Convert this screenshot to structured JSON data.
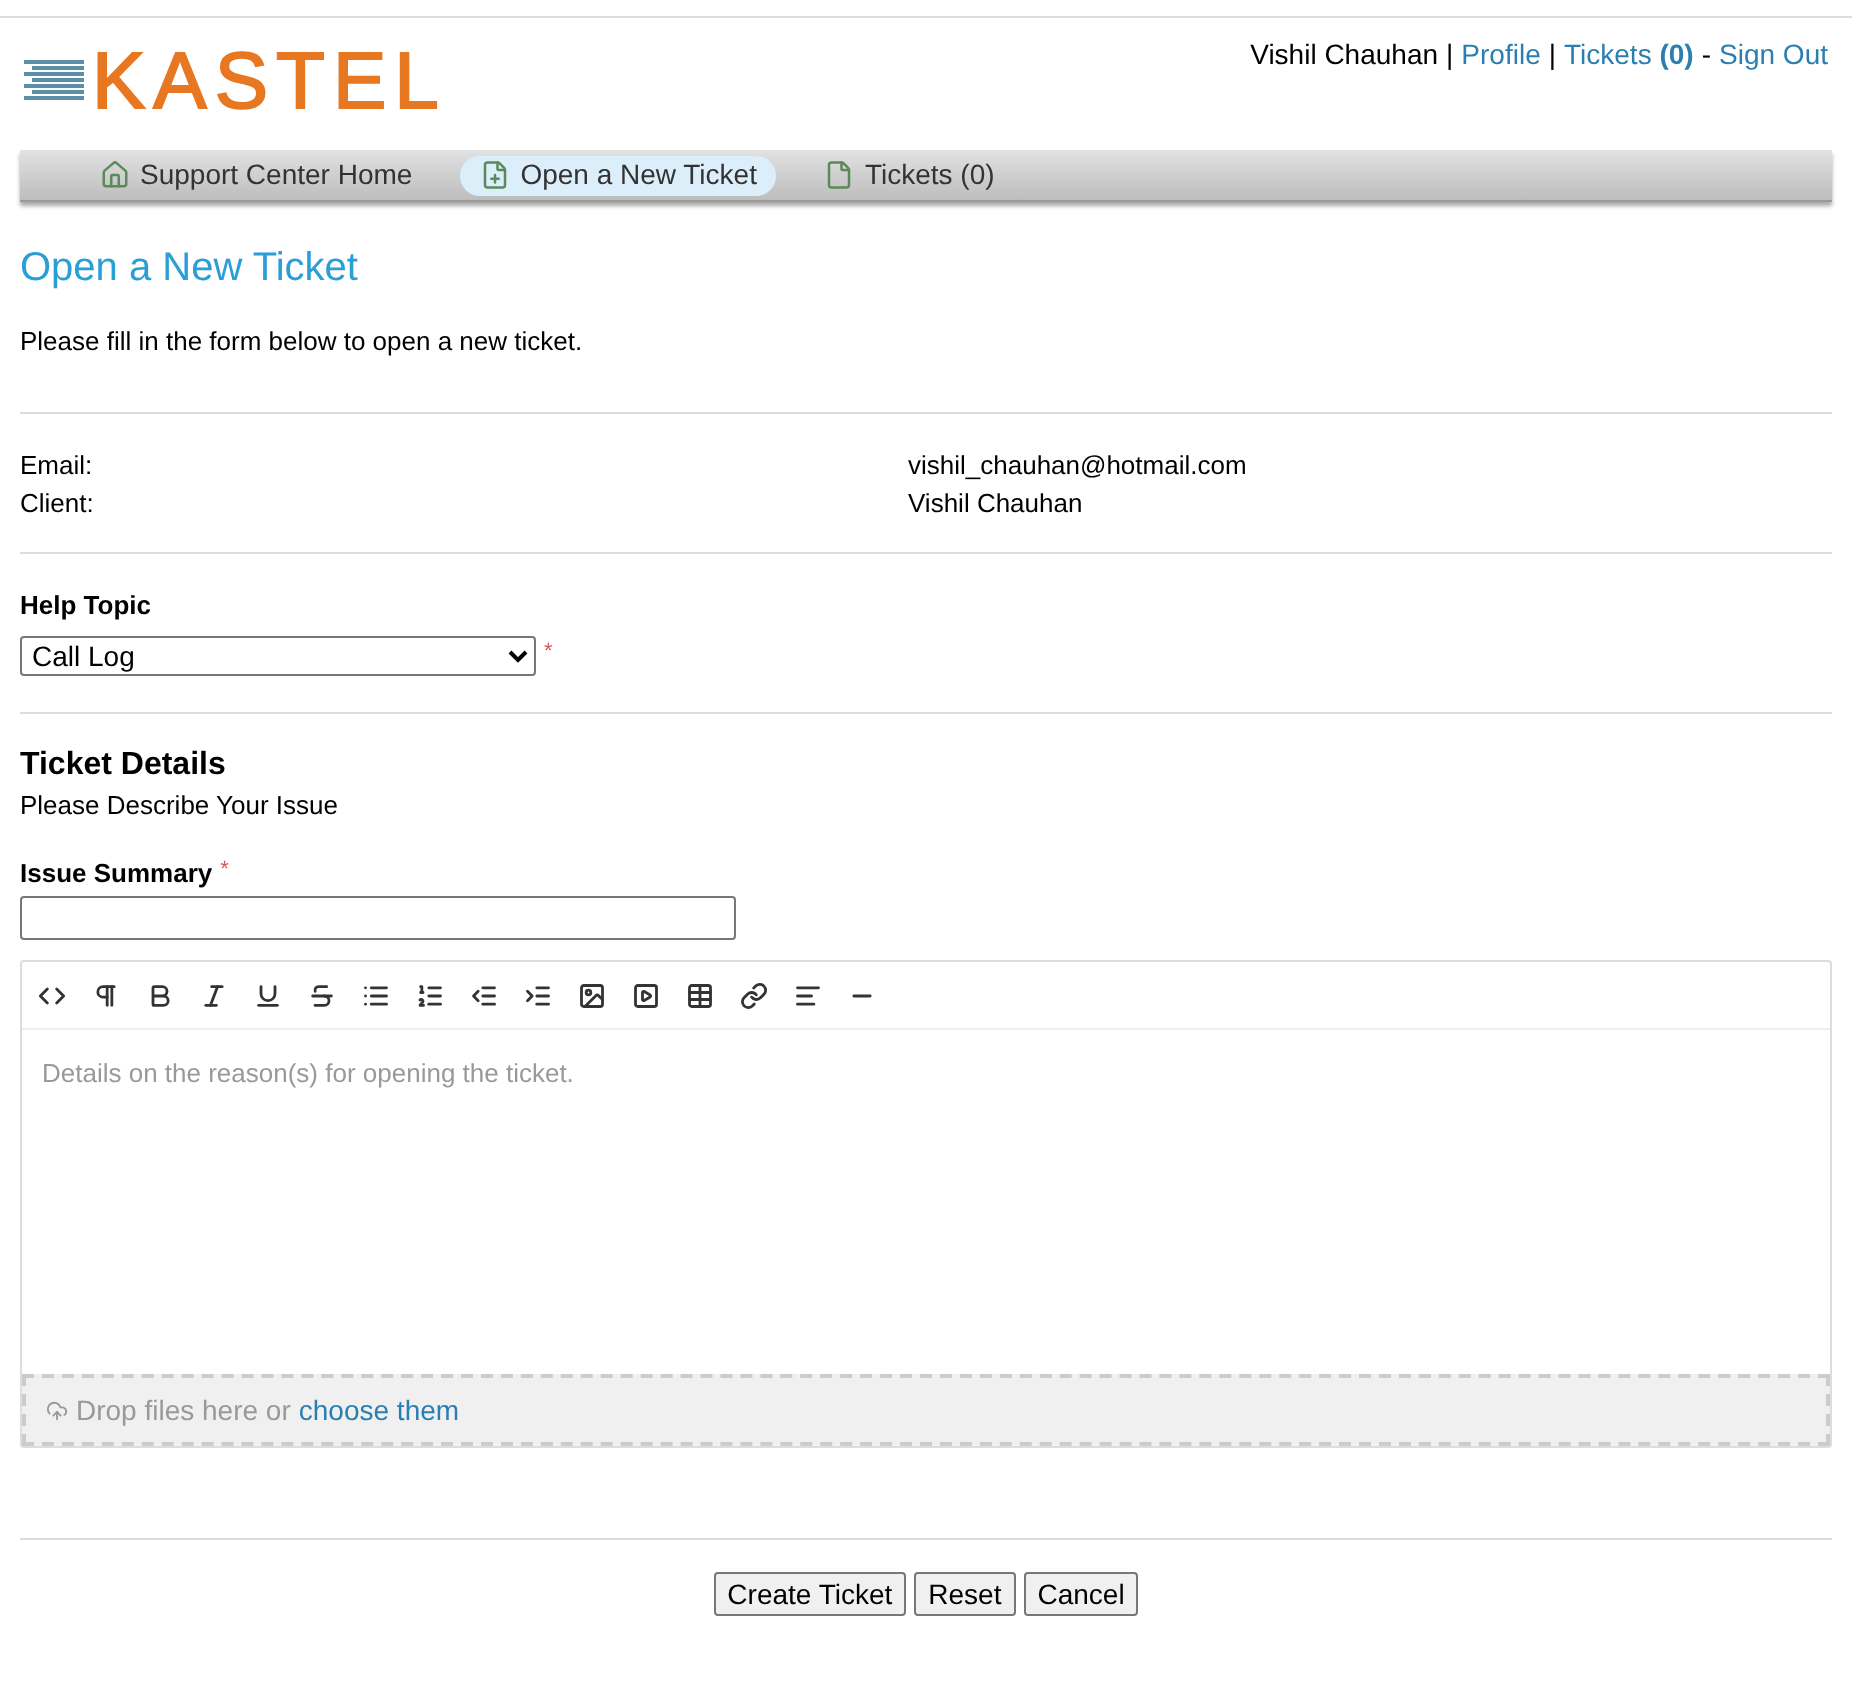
{
  "logo": "KASTEL",
  "user_bar": {
    "name": "Vishil Chauhan",
    "profile": "Profile",
    "tickets": "Tickets",
    "tickets_count": "(0)",
    "sign_out": "Sign Out",
    "separators": [
      "|",
      "|",
      "-"
    ]
  },
  "nav": [
    {
      "label": "Support Center Home",
      "kind": "home",
      "selected": false
    },
    {
      "label": "Open a New Ticket",
      "kind": "new",
      "selected": true
    },
    {
      "label": "Tickets (0)",
      "kind": "tickets",
      "selected": false
    }
  ],
  "page_title": "Open a New Ticket",
  "intro": "Please fill in the form below to open a new ticket.",
  "info": [
    {
      "label": "Email:",
      "value": "vishil_chauhan@hotmail.com"
    },
    {
      "label": "Client:",
      "value": "Vishil Chauhan"
    }
  ],
  "help_topic": {
    "label": "Help Topic",
    "value": "Call Log",
    "required_mark": "*"
  },
  "details": {
    "title": "Ticket Details",
    "subtitle": "Please Describe Your Issue"
  },
  "summary": {
    "label": "Issue Summary",
    "required_mark": "*"
  },
  "editor": {
    "placeholder": "Details on the reason(s) for opening the ticket.",
    "drop_text": "Drop files here or",
    "drop_link": "choose them"
  },
  "buttons": [
    "Create Ticket",
    "Reset",
    "Cancel"
  ]
}
